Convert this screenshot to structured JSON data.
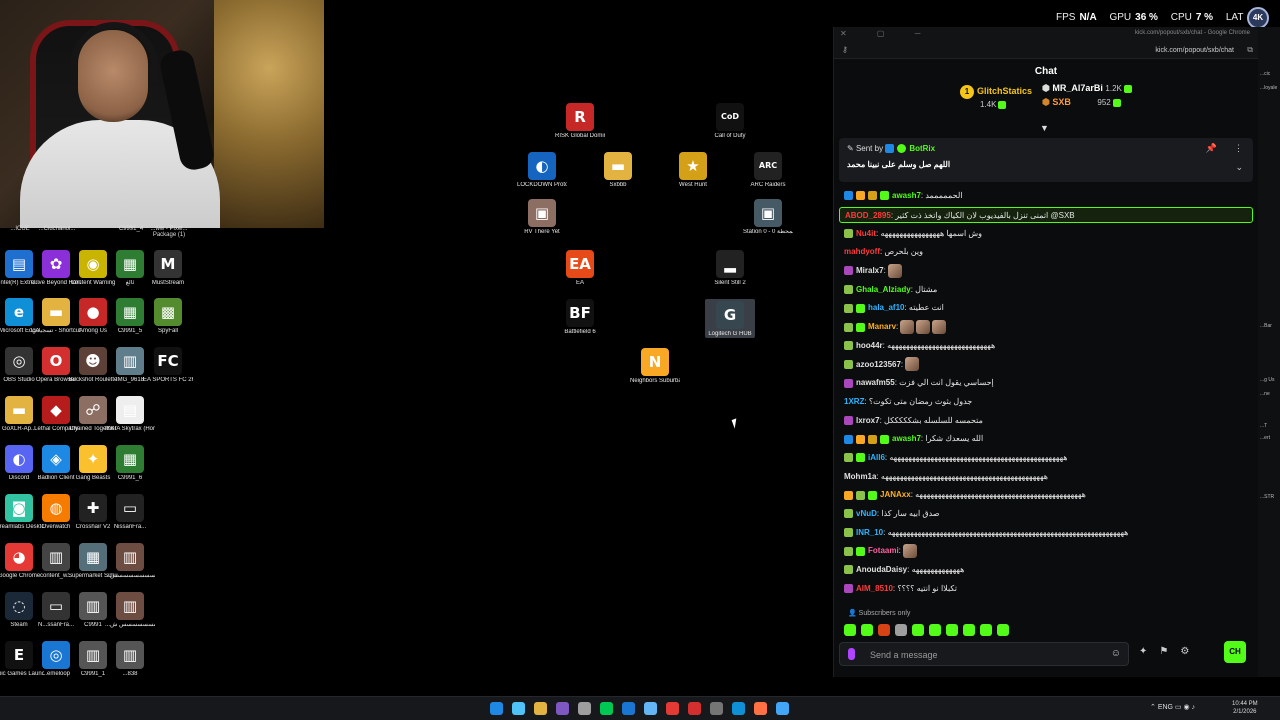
{
  "overlay": {
    "fps_label": "FPS",
    "fps_value": "N/A",
    "gpu_label": "GPU",
    "gpu_value": "36 %",
    "cpu_label": "CPU",
    "cpu_value": "7 %",
    "lat_label": "LAT",
    "badge_text": "4K"
  },
  "desktop_left": [
    {
      "label": "Intel(R) Extre...",
      "glyph": "▤",
      "color": "#1f6fd1"
    },
    {
      "label": "Drive Beyond Horizons",
      "glyph": "✿",
      "color": "#8b2fd9"
    },
    {
      "label": "Content Warning",
      "glyph": "◉",
      "color": "#c9b400"
    },
    {
      "label": "ئالغ",
      "glyph": "▦",
      "color": "#2e7d32"
    },
    {
      "label": "MustStream",
      "glyph": "M",
      "color": "#333333"
    },
    {
      "label": "Microsoft Edge",
      "glyph": "e",
      "color": "#0f8fd6"
    },
    {
      "label": "تسجيلات - Shortcut",
      "glyph": "▬",
      "color": "#e3b341"
    },
    {
      "label": "Among Us",
      "glyph": "●",
      "color": "#c62828"
    },
    {
      "label": "C9991_5",
      "glyph": "▦",
      "color": "#2e7d32"
    },
    {
      "label": "SpyFall",
      "glyph": "▩",
      "color": "#558b2f"
    },
    {
      "label": "OBS Studio",
      "glyph": "◎",
      "color": "#333333"
    },
    {
      "label": "Opera Browser",
      "glyph": "O",
      "color": "#d32f2f"
    },
    {
      "label": "Buckshot Roulette",
      "glyph": "☻",
      "color": "#5d4037"
    },
    {
      "label": "IMG_9618",
      "glyph": "▥",
      "color": "#607d8b"
    },
    {
      "label": "EA SPORTS FC 26",
      "glyph": "FC",
      "color": "#111111"
    },
    {
      "label": "GoXLR-Ap...",
      "glyph": "▬",
      "color": "#e3b341"
    },
    {
      "label": "Lethal Company",
      "glyph": "◆",
      "color": "#b71c1c"
    },
    {
      "label": "Chained Together",
      "glyph": "☍",
      "color": "#8d6e63"
    },
    {
      "label": "IKKIA Skytrax (Horiz.) ed...",
      "glyph": "▤",
      "color": "#eeeeee"
    },
    {
      "label": "Discord",
      "glyph": "◐",
      "color": "#5865f2"
    },
    {
      "label": "Badlion Client",
      "glyph": "◈",
      "color": "#1e88e5"
    },
    {
      "label": "Gang Beasts",
      "glyph": "✦",
      "color": "#fbc02d"
    },
    {
      "label": "C9991_6",
      "glyph": "▦",
      "color": "#2e7d32"
    },
    {
      "label": "Streamlabs Desktop",
      "glyph": "◙",
      "color": "#31c3a2"
    },
    {
      "label": "Overwatch",
      "glyph": "◍",
      "color": "#f57c00"
    },
    {
      "label": "Crosshair V2",
      "glyph": "✚",
      "color": "#222222"
    },
    {
      "label": "NissanFra...",
      "glyph": "▭",
      "color": "#222222"
    },
    {
      "label": "Google Chrome",
      "glyph": "◕",
      "color": "#e53935"
    },
    {
      "label": "content_w...",
      "glyph": "▥",
      "color": "#444444"
    },
    {
      "label": "Supermarket Simulator",
      "glyph": "▦",
      "color": "#546e7a"
    },
    {
      "label": "...بسسسسسسسسسسسسس",
      "glyph": "▥",
      "color": "#6d4c41"
    },
    {
      "label": "Steam",
      "glyph": "◌",
      "color": "#1b2838"
    },
    {
      "label": "N...ssanFra...",
      "glyph": "▭",
      "color": "#333333"
    },
    {
      "label": "C9991",
      "glyph": "▥",
      "color": "#555555"
    },
    {
      "label": "...بسسسسسسس ش",
      "glyph": "▥",
      "color": "#6d4c41"
    },
    {
      "label": "Epic Games Launcher",
      "glyph": "E",
      "color": "#111111"
    },
    {
      "label": "...emeloop",
      "glyph": "◎",
      "color": "#1976d2"
    },
    {
      "label": "C9991_1",
      "glyph": "▥",
      "color": "#555555"
    },
    {
      "label": "...838",
      "glyph": "▥",
      "color": "#555555"
    }
  ],
  "desktop_partial": [
    "...ICUE",
    "...Ciuchanoi...",
    "C9991_4",
    "...ww - Pixel... Package (1)"
  ],
  "desktop_center": [
    {
      "label": "RISK Global Domination",
      "glyph": "R",
      "color": "#c62828"
    },
    {
      "label": "Call of Duty",
      "glyph": "CoD",
      "color": "#111111"
    },
    {
      "label": "LOCKDOWN Protocol",
      "glyph": "◐",
      "color": "#1565c0"
    },
    {
      "label": "Sxbbb",
      "glyph": "▬",
      "color": "#e3b341"
    },
    {
      "label": "West Hunt",
      "glyph": "★",
      "color": "#d4a017"
    },
    {
      "label": "ARC Raiders",
      "glyph": "ARC",
      "color": "#222222"
    },
    {
      "label": "RV There Yet",
      "glyph": "▣",
      "color": "#8d6e63"
    },
    {
      "label": "Station 0 - المحطة 0",
      "glyph": "▣",
      "color": "#455a64"
    },
    {
      "label": "EA",
      "glyph": "EA",
      "color": "#e64a19"
    },
    {
      "label": "Silent Still 2",
      "glyph": "▂",
      "color": "#222222"
    },
    {
      "label": "Battlefield 6",
      "glyph": "BF",
      "color": "#111111"
    },
    {
      "label": "Logitech G HUB",
      "glyph": "G",
      "color": "#37474f"
    },
    {
      "label": "Neighbors Suburba...",
      "glyph": "N",
      "color": "#f9a825"
    }
  ],
  "chat": {
    "window_title": "kick.com/popout/sxb/chat - Google Chrome",
    "url": "kick.com/popout/sxb/chat",
    "title": "Chat",
    "leaderboard": [
      {
        "rank": "1",
        "name": "GlitchStatics",
        "count": "1.4K"
      },
      {
        "name": "MR_Al7arBi",
        "count": "1.2K"
      },
      {
        "name": "SXB",
        "count": "952"
      }
    ],
    "pinned": {
      "sent_by_label": "Sent by",
      "user": "BotRix",
      "text": "اللهم صل وسلم على نبينا محمد"
    },
    "messages": [
      {
        "user": "awash7",
        "color": "#53fc18",
        "text": "الحمممممد",
        "badges": [
          "#1e88e5",
          "#f9a825",
          "#d4a017",
          "#53fc18"
        ]
      },
      {
        "user": "ABOD_2895",
        "color": "#ff3b3b",
        "text": "اتمنى تنزل بالفيديوب لان الكياك واتخذ ذت كثير @SXB",
        "highlight": true
      },
      {
        "user": "Nu4it",
        "color": "#ff3b3b",
        "text": "وش اسمها ههههههههههههههههه",
        "badges": [
          "#8bc34a"
        ]
      },
      {
        "user": "mahdyoff",
        "color": "#ff3b3b",
        "text": "وين بلحرص"
      },
      {
        "user": "Miralx7",
        "color": "#e0e0e0",
        "text": "",
        "badges": [
          "#ab47bc"
        ],
        "emotes": 1
      },
      {
        "user": "Ghala_Alziady",
        "color": "#53fc18",
        "text": "مشتال",
        "badges": [
          "#8bc34a"
        ]
      },
      {
        "user": "hala_af10",
        "color": "#2fb5ff",
        "text": "انت عطيته",
        "badges": [
          "#8bc34a",
          "#53fc18"
        ]
      },
      {
        "user": "Manarv",
        "color": "#ffb020",
        "text": "",
        "badges": [
          "#8bc34a",
          "#53fc18"
        ],
        "emotes": 3
      },
      {
        "user": "hoo44r",
        "color": "#e0e0e0",
        "text": "ههههههههههههههههههههههههههههه",
        "badges": [
          "#8bc34a"
        ]
      },
      {
        "user": "azoo123567",
        "color": "#e0e0e0",
        "text": "",
        "badges": [
          "#8bc34a"
        ],
        "emotes": 1
      },
      {
        "user": "nawafm55",
        "color": "#e0e0e0",
        "text": "إحساسي يقول انت الي فزت",
        "badges": [
          "#ab47bc"
        ]
      },
      {
        "user": "1XRZ",
        "color": "#2fb5ff",
        "text": "جدول بثوث رمضان متى تكوت؟"
      },
      {
        "user": "lxrox7",
        "color": "#e0e0e0",
        "text": "متحمسه للسلسله بشكككككل",
        "badges": [
          "#ab47bc"
        ]
      },
      {
        "user": "awash7",
        "color": "#53fc18",
        "text": "الله يسعدك شكرا",
        "badges": [
          "#1e88e5",
          "#f9a825",
          "#d4a017",
          "#53fc18"
        ]
      },
      {
        "user": "iAll6",
        "color": "#2fb5ff",
        "text": "هههههههههههههههههههههههههههههههههههههههههههههههه",
        "badges": [
          "#8bc34a",
          "#53fc18"
        ]
      },
      {
        "user": "Mohm1a",
        "color": "#e0e0e0",
        "text": "ههههههههههههههههههههههههههههههههههههههههههههه"
      },
      {
        "user": "JANAxx",
        "color": "#ffb020",
        "text": "هههههههههههههههههههههههههههههههههههههههههههههه",
        "badges": [
          "#f9a825",
          "#8bc34a",
          "#53fc18"
        ]
      },
      {
        "user": "vNuD",
        "color": "#2fb5ff",
        "text": "صدق ابيه سار كذا",
        "badges": [
          "#8bc34a"
        ]
      },
      {
        "user": "INR_10",
        "color": "#2fb5ff",
        "text": "ههههههههههههههههههههههههههههههههههههههههههههههههههههههههههههههههه",
        "badges": [
          "#8bc34a"
        ]
      },
      {
        "user": "Fotaami",
        "color": "#ff5fa2",
        "text": "",
        "badges": [
          "#8bc34a",
          "#53fc18"
        ],
        "emotes": 1
      },
      {
        "user": "AnoudaDaisy",
        "color": "#e0e0e0",
        "text": "هههههههههههههه",
        "badges": [
          "#8bc34a"
        ]
      },
      {
        "user": "AIM_8510",
        "color": "#ff3b3b",
        "text": "تكبلاا نو انتيه ؟؟؟؟",
        "badges": [
          "#ab47bc"
        ]
      }
    ],
    "subscribers_only": "Subscribers only",
    "input_placeholder": "Send a message",
    "send_label": "CH"
  },
  "right_strip": [
    "...cic",
    "...loyale",
    "...Bar",
    "...g Us",
    "...ne",
    "...T",
    "...ert",
    "...STR"
  ],
  "taskbar": {
    "icons": [
      "#1e88e5",
      "#4fc3f7",
      "#e3b341",
      "#7e57c2",
      "#9e9e9e",
      "#00c853",
      "#1976d2",
      "#64b5f6",
      "#e53935",
      "#d32f2f",
      "#757575",
      "#0f8fd6",
      "#ff7043",
      "#42a5f5"
    ],
    "tray": "ENG",
    "time": "10:44 PM",
    "date": "2/1/2026"
  },
  "colors": {
    "accent": "#53fc18",
    "chat_bg": "#0b0c0d"
  }
}
